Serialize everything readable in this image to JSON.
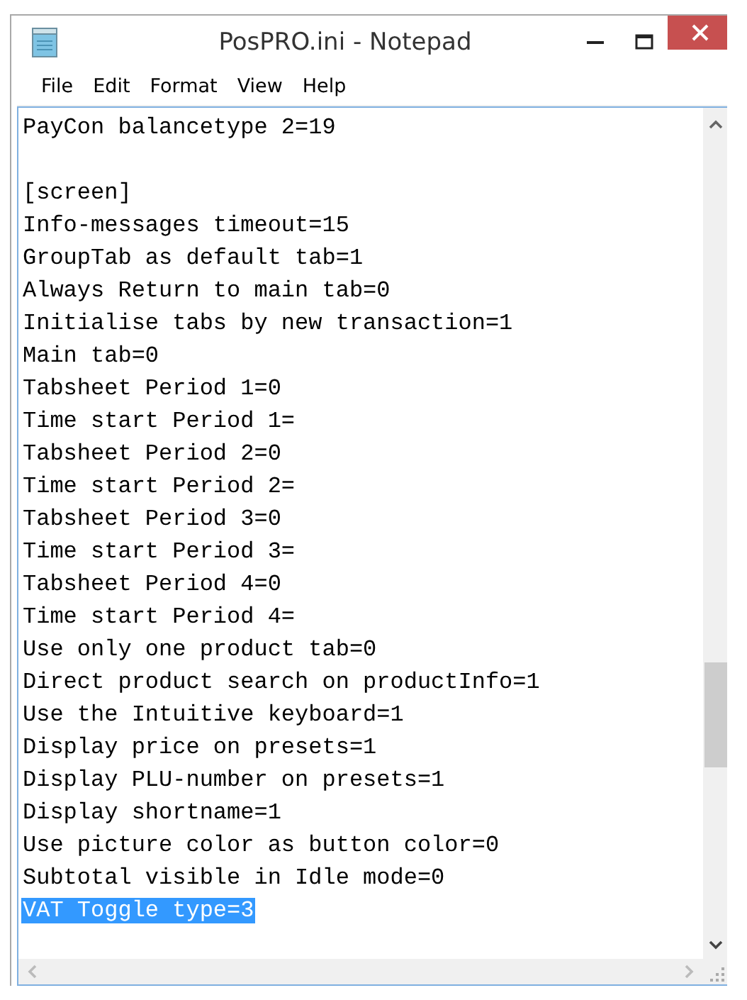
{
  "window": {
    "title": "PosPRO.ini - Notepad"
  },
  "menu": [
    {
      "label": "File"
    },
    {
      "label": "Edit"
    },
    {
      "label": "Format"
    },
    {
      "label": "View"
    },
    {
      "label": "Help"
    }
  ],
  "lines": [
    {
      "kind": "text",
      "text": "PayCon balancetype 2=19",
      "selected": false
    },
    {
      "kind": "blank"
    },
    {
      "kind": "text",
      "text": "[screen]",
      "selected": false
    },
    {
      "kind": "text",
      "text": "Info-messages timeout=15",
      "selected": false
    },
    {
      "kind": "text",
      "text": "GroupTab as default tab=1",
      "selected": false
    },
    {
      "kind": "text",
      "text": "Always Return to main tab=0",
      "selected": false
    },
    {
      "kind": "text",
      "text": "Initialise tabs by new transaction=1",
      "selected": false
    },
    {
      "kind": "text",
      "text": "Main tab=0",
      "selected": false
    },
    {
      "kind": "text",
      "text": "Tabsheet Period 1=0",
      "selected": false
    },
    {
      "kind": "text",
      "text": "Time start Period 1=",
      "selected": false
    },
    {
      "kind": "text",
      "text": "Tabsheet Period 2=0",
      "selected": false
    },
    {
      "kind": "text",
      "text": "Time start Period 2=",
      "selected": false
    },
    {
      "kind": "text",
      "text": "Tabsheet Period 3=0",
      "selected": false
    },
    {
      "kind": "text",
      "text": "Time start Period 3=",
      "selected": false
    },
    {
      "kind": "text",
      "text": "Tabsheet Period 4=0",
      "selected": false
    },
    {
      "kind": "text",
      "text": "Time start Period 4=",
      "selected": false
    },
    {
      "kind": "text",
      "text": "Use only one product tab=0",
      "selected": false
    },
    {
      "kind": "text",
      "text": "Direct product search on productInfo=1",
      "selected": false
    },
    {
      "kind": "text",
      "text": "Use the Intuitive keyboard=1",
      "selected": false
    },
    {
      "kind": "text",
      "text": "Display price on presets=1",
      "selected": false
    },
    {
      "kind": "text",
      "text": "Display PLU-number on presets=1",
      "selected": false
    },
    {
      "kind": "text",
      "text": "Display shortname=1",
      "selected": false
    },
    {
      "kind": "text",
      "text": "Use picture color as button color=0",
      "selected": false
    },
    {
      "kind": "text",
      "text": "Subtotal visible in Idle mode=0",
      "selected": false
    },
    {
      "kind": "text",
      "text": "VAT Toggle type=3",
      "selected": true
    }
  ]
}
